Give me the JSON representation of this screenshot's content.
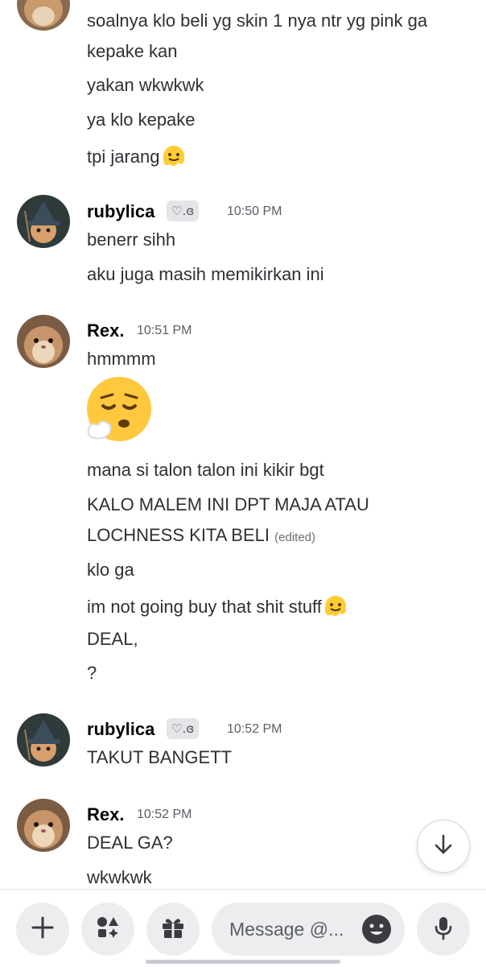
{
  "messages": {
    "m0_line1": "soalnya klo beli yg skin 1 nya ntr yg pink ga",
    "m0_line2": "kepake kan",
    "m1": "yakan wkwkwk",
    "m2": "ya klo kepake",
    "m3": "tpi jarang"
  },
  "group1": {
    "author": "rubylica",
    "badge": "♡.ɞ",
    "time": "10:50 PM",
    "lines": [
      "benerr sihh",
      "aku juga masih memikirkan ini"
    ]
  },
  "group2": {
    "author": "Rex.",
    "time": "10:51 PM",
    "lines": [
      "hmmmm",
      "mana si talon talon ini kikir bgt",
      "KALO MALEM INI DPT MAJA ATAU",
      "LOCHNESS KITA BELI",
      "klo ga",
      "im not going buy that shit stuff",
      "DEAL,",
      "?"
    ],
    "edited": "(edited)"
  },
  "group3": {
    "author": "rubylica",
    "badge": "♡.ɞ",
    "time": "10:52 PM",
    "lines": [
      "TAKUT BANGETT"
    ]
  },
  "group4": {
    "author": "Rex.",
    "time": "10:52 PM",
    "lines": [
      "DEAL GA?",
      "wkwkwk"
    ]
  },
  "composer": {
    "placeholder": "Message @..."
  },
  "icons": {
    "add": "plus-icon",
    "apps": "apps-icon",
    "gift": "gift-icon",
    "emoji": "emoji-icon",
    "mic": "microphone-icon",
    "scroll": "arrow-down-icon"
  }
}
